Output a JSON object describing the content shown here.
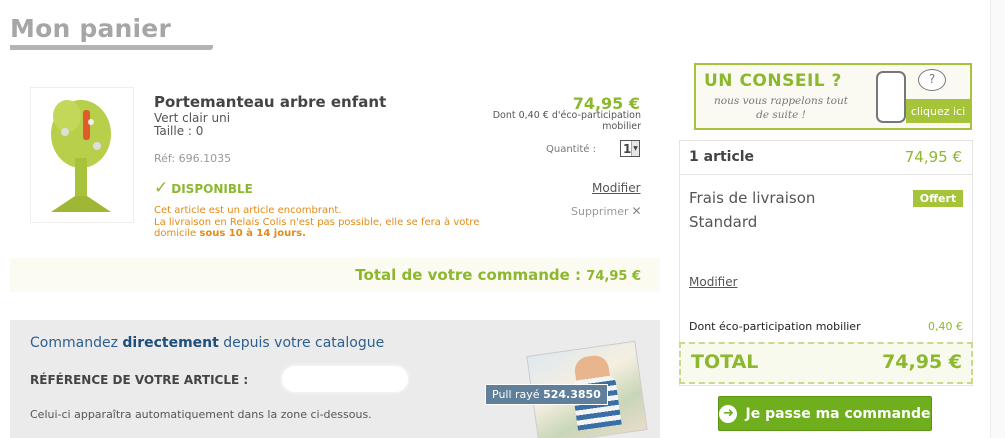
{
  "header": {
    "title": "Mon panier"
  },
  "product": {
    "name": "Portemanteau arbre enfant",
    "color": "Vert clair uni",
    "size": "Taille : 0",
    "ref": "Réf: 696.1035",
    "availability": "DISPONIBLE",
    "notice_line1": "Cet article est un article encombrant.",
    "notice_line2": "La livraison en Relais Colis n'est pas possible, elle se fera à votre",
    "notice_line3_a": "domicile ",
    "notice_line3_b": "sous 10 à 14 jours.",
    "price": "74,95 €",
    "eco_note": "Dont 0,40 € d'éco-participation mobilier",
    "quantity_label": "Quantité :",
    "quantity_value": "1",
    "modify_label": "Modifier",
    "delete_label": "Supprimer"
  },
  "order_total": {
    "label": "Total de votre commande :",
    "amount": "74,95 €"
  },
  "catalog": {
    "title_a": "Commandez ",
    "title_b": "directement",
    "title_c": " depuis votre catalogue",
    "ref_label": "RÉFÉRENCE DE VOTRE ARTICLE :",
    "ref_value": "",
    "hint": "Celui-ci apparaîtra automatiquement dans la zone ci-dessous.",
    "tag_label": "Pull rayé",
    "tag_ref": "524.3850"
  },
  "advice": {
    "title": "UN CONSEIL ?",
    "subtitle": "nous vous rappelons tout de suite !",
    "bubble": "?",
    "button": "cliquez ici"
  },
  "summary": {
    "articles_label": "1 article",
    "articles_amount": "74,95 €",
    "shipping_label": "Frais de livraison Standard",
    "shipping_badge": "Offert",
    "shipping_modify": "Modifier",
    "eco_label": "Dont éco-participation mobilier",
    "eco_amount": "0,40 €",
    "total_label": "TOTAL",
    "total_amount": "74,95 €",
    "checkout_label": "Je passe ma commande"
  },
  "colors": {
    "accent_green": "#8cb82f",
    "button_green": "#6fae1d",
    "orange_notice": "#e38a16",
    "catalog_blue": "#2d5f8e"
  },
  "icons": [
    "check-icon",
    "close-icon",
    "arrow-right-icon",
    "phone-icon",
    "question-bubble-icon",
    "chevron-down-icon"
  ]
}
